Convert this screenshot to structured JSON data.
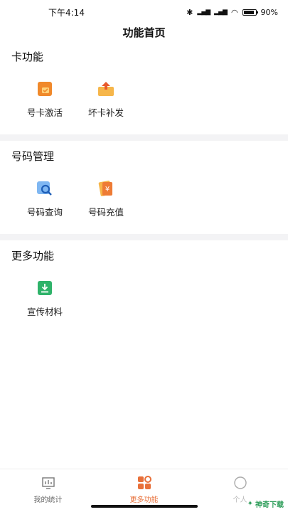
{
  "status_bar": {
    "time": "下午4:14",
    "battery": "90%"
  },
  "header": {
    "title": "功能首页"
  },
  "sections": [
    {
      "title": "卡功能",
      "items": [
        {
          "label": "号卡激活"
        },
        {
          "label": "坏卡补发"
        }
      ]
    },
    {
      "title": "号码管理",
      "items": [
        {
          "label": "号码查询"
        },
        {
          "label": "号码充值"
        }
      ]
    },
    {
      "title": "更多功能",
      "items": [
        {
          "label": "宣传材料"
        }
      ]
    }
  ],
  "tabbar": {
    "tabs": [
      {
        "label": "我的统计"
      },
      {
        "label": "更多功能"
      },
      {
        "label": "个人"
      }
    ]
  },
  "watermark": {
    "text": "神奇下载"
  },
  "colors": {
    "accent": "#e8703a",
    "orange": "#f0892b",
    "blue": "#3c8ee6",
    "green": "#2fb36a"
  }
}
